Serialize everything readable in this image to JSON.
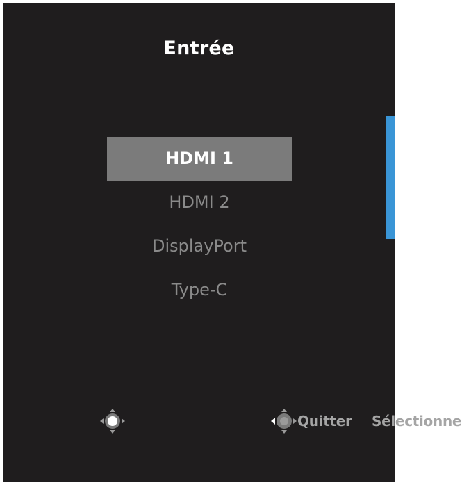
{
  "menu": {
    "title": "Entrée",
    "options": [
      {
        "label": "HDMI 1",
        "selected": true
      },
      {
        "label": "HDMI 2",
        "selected": false
      },
      {
        "label": "DisplayPort",
        "selected": false
      },
      {
        "label": "Type-C",
        "selected": false
      }
    ]
  },
  "footer": {
    "joystick_left_icon": "joystick-press-icon",
    "joystick_right_icon": "joystick-left-icon",
    "quit_label": "Quitter",
    "select_label": "Sélectionner"
  },
  "colors": {
    "panel_background": "#1f1d1e",
    "selected_background": "#7b7b7b",
    "accent_scrollbar": "#3a95d6",
    "inactive_text": "#8a8a8a"
  }
}
